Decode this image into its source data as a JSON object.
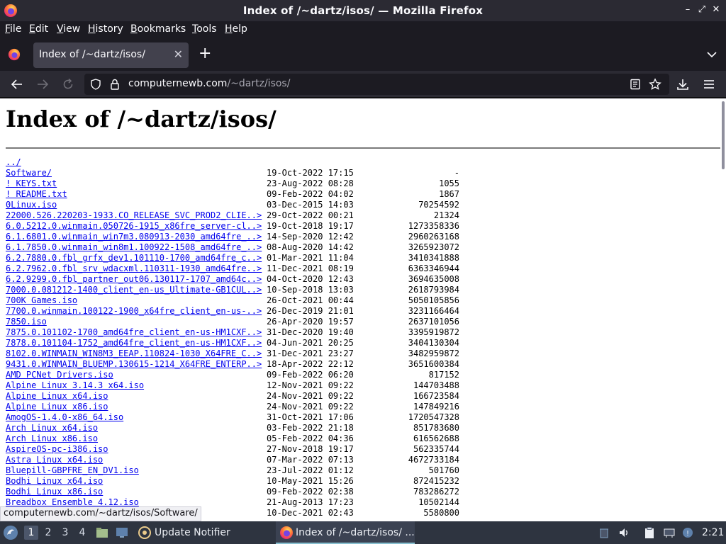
{
  "window": {
    "title": "Index of /~dartz/isos/ — Mozilla Firefox"
  },
  "menu": [
    "File",
    "Edit",
    "View",
    "History",
    "Bookmarks",
    "Tools",
    "Help"
  ],
  "tab": {
    "label": "Index of /~dartz/isos/"
  },
  "url": {
    "host": "computernewb.com",
    "path": "/~dartz/isos/"
  },
  "page": {
    "heading": "Index of /~dartz/isos/"
  },
  "listing": [
    {
      "name": "../",
      "date": "",
      "size": ""
    },
    {
      "name": "Software/",
      "date": "19-Oct-2022 17:15",
      "size": "-"
    },
    {
      "name": "! KEYS.txt",
      "date": "23-Aug-2022 08:28",
      "size": "1055"
    },
    {
      "name": "! README.txt",
      "date": "09-Feb-2022 04:02",
      "size": "1867"
    },
    {
      "name": "0Linux.iso",
      "date": "03-Dec-2015 14:03",
      "size": "70254592"
    },
    {
      "name": "22000.526.220203-1933.CO_RELEASE_SVC_PROD2_CLIE..>",
      "date": "29-Oct-2022 00:21",
      "size": "21324"
    },
    {
      "name": "6.0.5212.0.winmain.050726-1915_x86fre_server-cl..>",
      "date": "19-Oct-2018 19:17",
      "size": "1273358336"
    },
    {
      "name": "6.1.6801.0.winmain_win7m3.080913-2030_amd64fre_..>",
      "date": "14-Sep-2020 12:42",
      "size": "2960263168"
    },
    {
      "name": "6.1.7850.0.winmain_win8m1.100922-1508_amd64fre_..>",
      "date": "08-Aug-2020 14:42",
      "size": "3265923072"
    },
    {
      "name": "6.2.7880.0.fbl_grfx_dev1.101110-1700_amd64fre_c..>",
      "date": "01-Mar-2021 11:04",
      "size": "3410341888"
    },
    {
      "name": "6.2.7962.0.fbl_srv_wdacxml.110311-1930_amd64fre..>",
      "date": "11-Dec-2021 08:19",
      "size": "6363346944"
    },
    {
      "name": "6.2.9299.0.fbl_partner_out06.130117-1707_amd64c..>",
      "date": "04-Oct-2020 12:43",
      "size": "3694635008"
    },
    {
      "name": "7000.0.081212-1400_client_en-us_Ultimate-GB1CUL..>",
      "date": "10-Sep-2018 13:03",
      "size": "2618793984"
    },
    {
      "name": "700K Games.iso",
      "date": "26-Oct-2021 00:44",
      "size": "5050105856"
    },
    {
      "name": "7700.0.winmain.100122-1900_x64fre_client_en-us-..>",
      "date": "26-Dec-2019 21:01",
      "size": "3231166464"
    },
    {
      "name": "7850.iso",
      "date": "26-Apr-2020 19:57",
      "size": "2637101056"
    },
    {
      "name": "7875.0.101102-1700_amd64fre_client_en-us-HM1CXF..>",
      "date": "31-Dec-2020 19:40",
      "size": "3395919872"
    },
    {
      "name": "7878.0.101104-1752_amd64fre_client_en-us-HM1CXF..>",
      "date": "04-Jun-2021 20:25",
      "size": "3404130304"
    },
    {
      "name": "8102.0.WINMAIN_WIN8M3_EEAP.110824-1030_X64FRE_C..>",
      "date": "31-Dec-2021 23:27",
      "size": "3482959872"
    },
    {
      "name": "9431.0.WINMAIN_BLUEMP.130615-1214_X64FRE_ENTERP..>",
      "date": "18-Apr-2022 22:12",
      "size": "3651600384"
    },
    {
      "name": "AMD PCNet Drivers.iso",
      "date": "09-Feb-2022 06:20",
      "size": "817152"
    },
    {
      "name": "Alpine Linux 3.14.3 x64.iso",
      "date": "12-Nov-2021 09:22",
      "size": "144703488"
    },
    {
      "name": "Alpine Linux x64.iso",
      "date": "24-Nov-2021 09:22",
      "size": "166723584"
    },
    {
      "name": "Alpine Linux x86.iso",
      "date": "24-Nov-2021 09:22",
      "size": "147849216"
    },
    {
      "name": "AmogOS-1.4.0-x86_64.iso",
      "date": "31-Oct-2021 17:06",
      "size": "1720547328"
    },
    {
      "name": "Arch Linux x64.iso",
      "date": "03-Feb-2022 21:18",
      "size": "851783680"
    },
    {
      "name": "Arch Linux x86.iso",
      "date": "05-Feb-2022 04:36",
      "size": "616562688"
    },
    {
      "name": "AspireOS-pc-i386.iso",
      "date": "27-Nov-2018 19:17",
      "size": "562335744"
    },
    {
      "name": "Astra Linux x64.iso",
      "date": "07-Mar-2022 07:13",
      "size": "4672733184"
    },
    {
      "name": "Bluepill-GBPFRE_EN_DV1.iso",
      "date": "23-Jul-2022 01:12",
      "size": "501760"
    },
    {
      "name": "Bodhi Linux x64.iso",
      "date": "10-May-2021 15:26",
      "size": "872415232"
    },
    {
      "name": "Bodhi Linux x86.iso",
      "date": "09-Feb-2022 02:38",
      "size": "783286272"
    },
    {
      "name": "Breadbox Ensemble 4.12.iso",
      "date": "21-Aug-2013 17:23",
      "size": "10502144"
    },
    {
      "name": "",
      "date": "10-Dec-2021 02:43",
      "size": "5580800"
    }
  ],
  "status_link": "computernewb.com/~dartz/isos/Software/",
  "taskbar": {
    "workspaces": [
      "1",
      "2",
      "3",
      "4"
    ],
    "update_notifier": "Update Notifier",
    "firefox_task": "Index of /~dartz/isos/ ...",
    "clock": "2:21"
  },
  "colors": {
    "link": "#0000ee",
    "toolbar": "#2b2a33",
    "background": "#1c1b22",
    "taskbar": "#2e3440"
  }
}
